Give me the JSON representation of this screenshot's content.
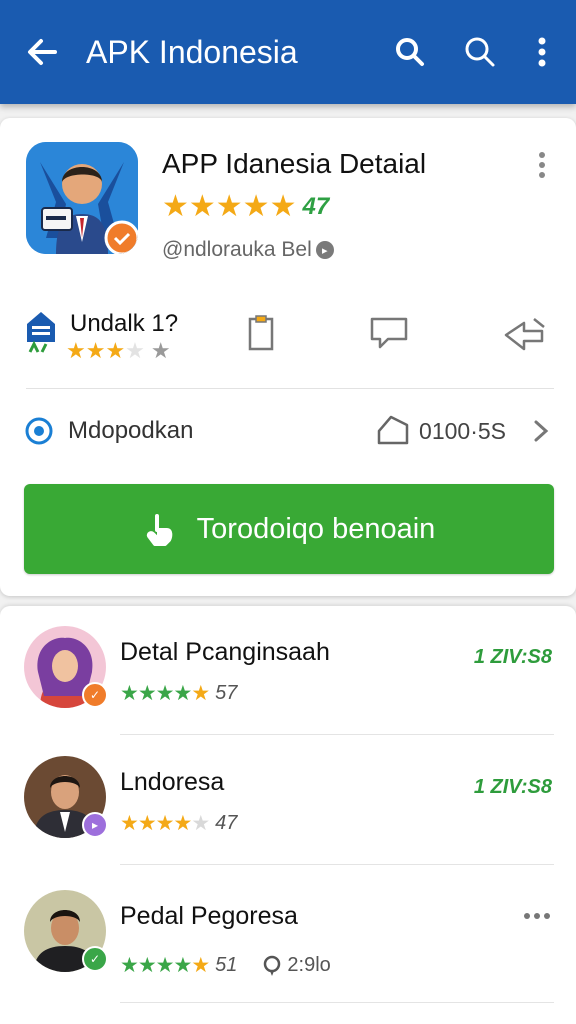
{
  "appbar": {
    "title": "APK Indonesia",
    "icons": [
      "back-arrow-icon",
      "search-icon",
      "search-icon",
      "more-vertical-icon"
    ],
    "color": "#1a5bb0"
  },
  "detail": {
    "app_name": "APP Idanesia Detaial",
    "rating_stars": 5,
    "rating_value": "7",
    "rating_prefix": "4",
    "developer": "@ndlorauka Bel",
    "stat_label": "Undalk 1?",
    "stat_stars": 3,
    "info_label": "Mdopodkan",
    "size_value": "0100·5S",
    "install_label": "Torodoiqo benoain",
    "accent_green": "#39a935",
    "star_color": "#f4a916"
  },
  "list": {
    "items": [
      {
        "title": "Detal Pcanginsaah",
        "rating_value": "57",
        "tag": "1 ZIV:S8",
        "badge_color": "#f07c2a"
      },
      {
        "title": "Lndoresa",
        "rating_value": "47",
        "tag": "1 ZIV:S8",
        "badge_color": "#9d6fdc"
      },
      {
        "title": "Pedal Pegoresa",
        "rating_value": "51",
        "comments": "2:9lo",
        "badge_color": "#3aa648"
      }
    ]
  }
}
